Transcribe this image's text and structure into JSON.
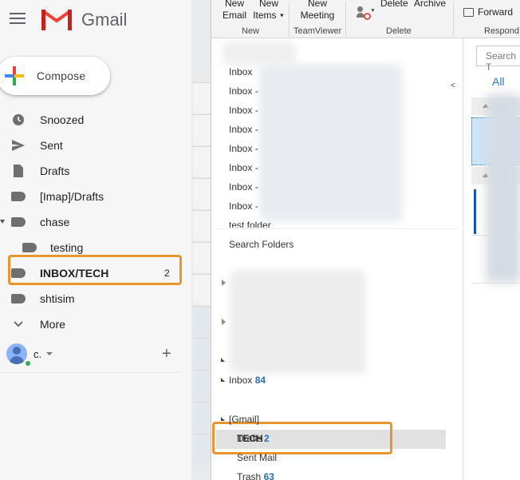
{
  "gmail": {
    "app_name": "Gmail",
    "compose_label": "Compose",
    "nav": [
      {
        "label": "Snoozed",
        "icon": "clock-icon"
      },
      {
        "label": "Sent",
        "icon": "send-icon"
      },
      {
        "label": "Drafts",
        "icon": "draft-icon"
      },
      {
        "label": "[Imap]/Drafts",
        "icon": "label-icon"
      },
      {
        "label": "chase",
        "icon": "label-icon"
      },
      {
        "label": "testing",
        "icon": "label-icon"
      },
      {
        "label": "INBOX/TECH",
        "icon": "label-icon",
        "count": "2"
      },
      {
        "label": "shtisim",
        "icon": "label-icon"
      },
      {
        "label": "More",
        "icon": "chevron-down-icon"
      }
    ],
    "chat_user": "c.",
    "highlight_color": "#e8952e"
  },
  "outlook": {
    "ribbon": {
      "new_email": [
        "New",
        "Email"
      ],
      "new_items": [
        "New",
        "Items"
      ],
      "new_meeting": [
        "New",
        "Meeting"
      ],
      "delete_label": "Delete",
      "archive_label": "Archive",
      "forward_label": "Forward",
      "groups": [
        "New",
        "TeamViewer",
        "Delete",
        "Respond"
      ]
    },
    "folders": {
      "inbox_rows": [
        "Inbox",
        "Inbox -",
        "Inbox -",
        "Inbox -",
        "Inbox -",
        "Inbox -",
        "Inbox -",
        "Inbox -"
      ],
      "test_folder": "test folder",
      "search_folders": "Search Folders",
      "inbox_label": "Inbox",
      "inbox_count": "84",
      "tech_label": "TECH",
      "tech_count": "2",
      "gmail_label": "[Gmail]",
      "drafts": "Drafts",
      "sent_mail": "Sent Mail",
      "trash_label": "Trash",
      "trash_count": "63"
    },
    "messages": {
      "search_placeholder": "Search T",
      "filter_all": "All"
    }
  }
}
